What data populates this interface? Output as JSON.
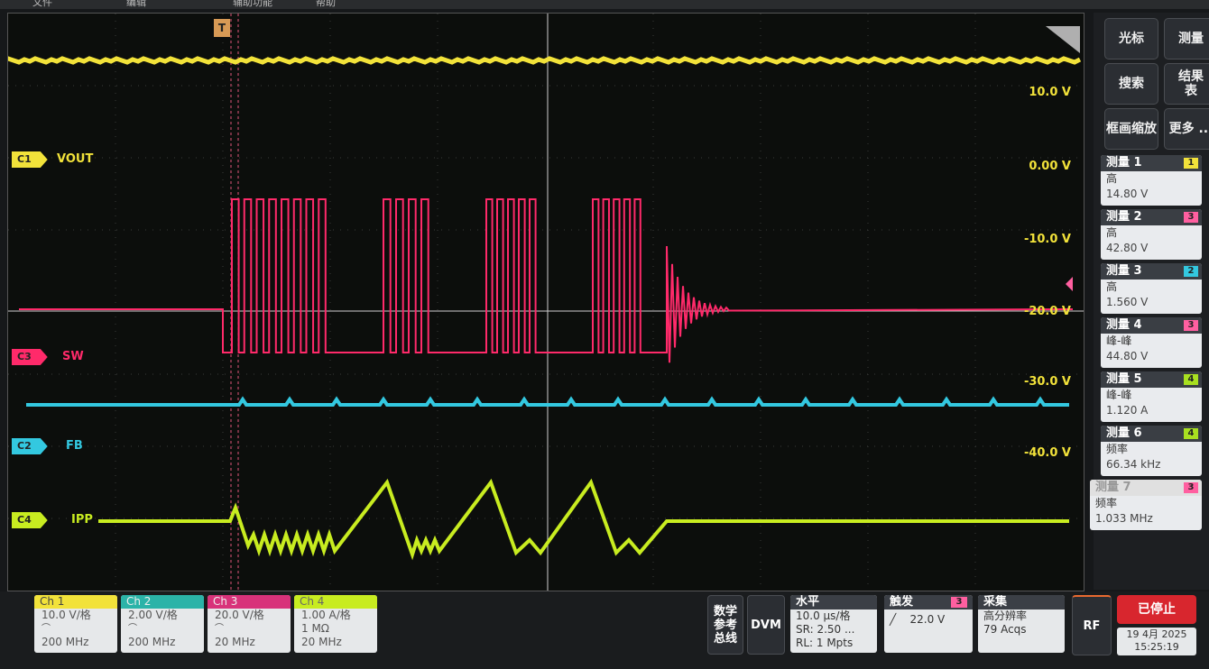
{
  "topbar": {
    "item1": "文件",
    "item2": "编辑",
    "item3": "辅助功能",
    "item4": "帮助"
  },
  "trigger_marker": "T",
  "scale_labels": [
    "10.0 V",
    "0.00 V",
    "-10.0 V",
    "-20.0 V",
    "-30.0 V",
    "-40.0 V"
  ],
  "channels": {
    "c1": {
      "tag": "C1",
      "name": "VOUT",
      "color": "#f2e23a"
    },
    "c3": {
      "tag": "C3",
      "name": "SW",
      "color": "#ff2a6a"
    },
    "c2": {
      "tag": "C2",
      "name": "FB",
      "color": "#33c8e0"
    },
    "c4": {
      "tag": "C4",
      "name": "IPP",
      "color": "#c8ec20"
    }
  },
  "right_buttons": {
    "cursor": "光标",
    "measure": "测量",
    "search": "搜索",
    "results": "结果\n表",
    "zoom": "框画缩放",
    "more": "更多 ..."
  },
  "measurements": [
    {
      "title": "测量 1",
      "badge": "1",
      "badge_color": "#f2e23a",
      "label": "高",
      "value": "14.80 V"
    },
    {
      "title": "测量 2",
      "badge": "3",
      "badge_color": "#ff5fa0",
      "label": "高",
      "value": "42.80 V"
    },
    {
      "title": "测量 3",
      "badge": "2",
      "badge_color": "#33c8e0",
      "label": "高",
      "value": "1.560 V"
    },
    {
      "title": "测量 4",
      "badge": "3",
      "badge_color": "#ff5fa0",
      "label": "峰-峰",
      "value": "44.80 V"
    },
    {
      "title": "测量 5",
      "badge": "4",
      "badge_color": "#a8e020",
      "label": "峰-峰",
      "value": "1.120 A"
    },
    {
      "title": "测量 6",
      "badge": "4",
      "badge_color": "#a8e020",
      "label": "频率",
      "value": "66.34 kHz"
    },
    {
      "title": "测量 7",
      "badge": "3",
      "badge_color": "#ff5fa0",
      "label": "频率",
      "value": "1.033 MHz"
    }
  ],
  "bottom": {
    "ch1": {
      "title": "Ch 1",
      "scale": "10.0 V/格",
      "bw": "200 MHz",
      "color": "#f2e23a"
    },
    "ch2": {
      "title": "Ch 2",
      "scale": "2.00 V/格",
      "bw": "200 MHz",
      "color": "#2bb3a8"
    },
    "ch3": {
      "title": "Ch 3",
      "scale": "20.0 V/格",
      "bw": "20 MHz",
      "color": "#d8327a"
    },
    "ch4": {
      "title": "Ch 4",
      "scale": "1.00 A/格",
      "imp": "1 MΩ",
      "bw": "20 MHz",
      "color": "#c8ec20"
    },
    "math": "数学\n参考\n总线",
    "dvm": "DVM",
    "horizontal": {
      "title": "水平",
      "scale": "10.0 μs/格",
      "sr": "SR: 2.50 ...",
      "rl": "RL: 1 Mpts"
    },
    "trigger": {
      "title": "触发",
      "badge": "3",
      "level": "22.0 V"
    },
    "acquire": {
      "title": "采集",
      "mode": "高分辨率",
      "acqs": "79 Acqs"
    },
    "rf": "RF",
    "stopped": "已停止",
    "date": "19 4月 2025",
    "time": "15:25:19"
  }
}
